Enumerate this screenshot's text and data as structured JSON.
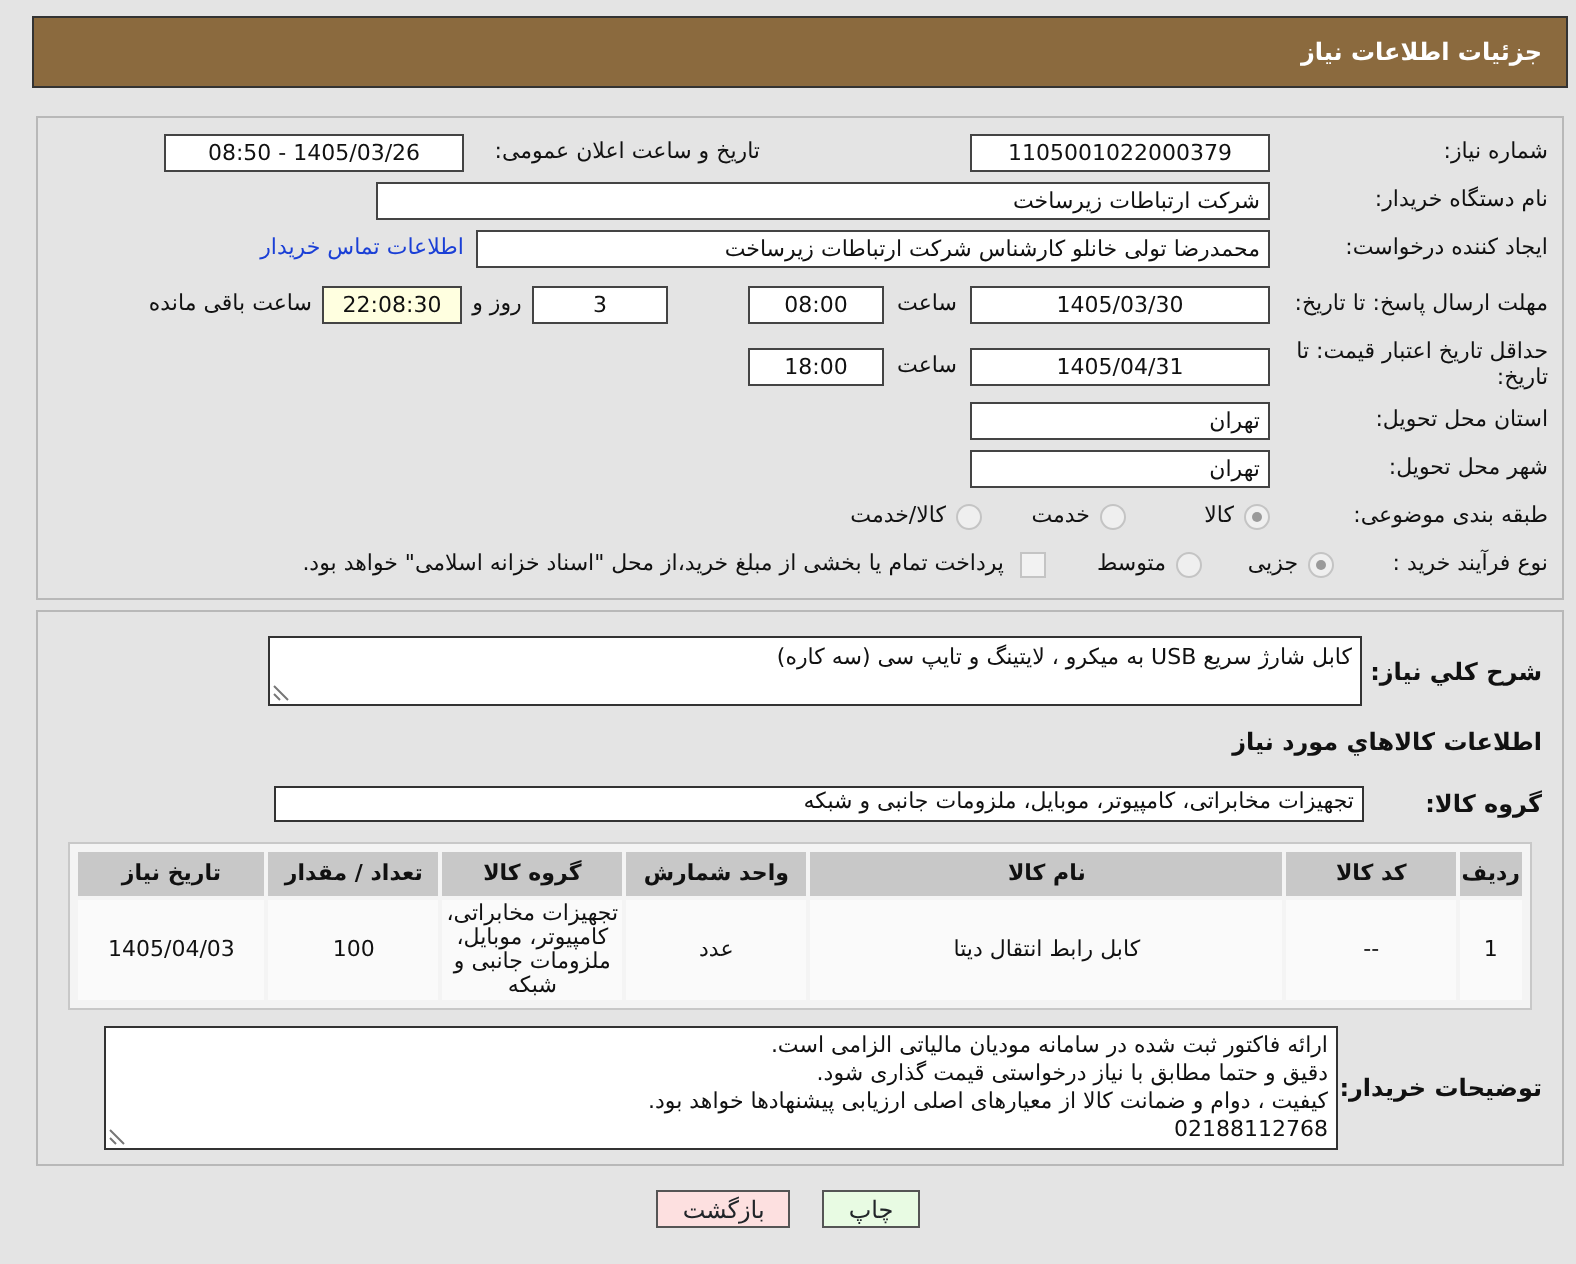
{
  "page_title": "جزئیات اطلاعات نیاز",
  "need_number": {
    "label": "شماره نیاز:",
    "value": "1105001022000379"
  },
  "announce": {
    "label": "تاریخ و ساعت اعلان عمومی:",
    "value": "1405/03/26 - 08:50"
  },
  "buyer_org": {
    "label": "نام دستگاه خریدار:",
    "value": "شرکت ارتباطات زیرساخت"
  },
  "creator": {
    "label": "ایجاد کننده درخواست:",
    "value": "محمدرضا تولی خانلو کارشناس شرکت ارتباطات زیرساخت",
    "link": "اطلاعات تماس خریدار"
  },
  "deadline": {
    "label": "مهلت ارسال پاسخ: تا تاریخ:",
    "date": "1405/03/30",
    "time_label": "ساعت",
    "time": "08:00",
    "days": "3",
    "days_label": "روز و",
    "remaining": "22:08:30",
    "remaining_label": "ساعت باقی مانده"
  },
  "validity": {
    "label": "حداقل تاریخ اعتبار قیمت: تا تاریخ:",
    "date": "1405/04/31",
    "time_label": "ساعت",
    "time": "18:00"
  },
  "province": {
    "label": "استان محل تحویل:",
    "value": "تهران"
  },
  "city": {
    "label": "شهر محل تحویل:",
    "value": "تهران"
  },
  "category": {
    "label": "طبقه بندی موضوعی:",
    "options": [
      {
        "label": "کالا",
        "selected": true
      },
      {
        "label": "خدمت",
        "selected": false
      },
      {
        "label": "کالا/خدمت",
        "selected": false
      }
    ]
  },
  "process": {
    "label": "نوع فرآیند خرید :",
    "options": [
      {
        "label": "جزیی",
        "selected": true
      },
      {
        "label": "متوسط",
        "selected": false
      }
    ],
    "payment": {
      "label": "پرداخت تمام یا بخشی از مبلغ خرید،از محل \"اسناد خزانه اسلامی\" خواهد بود.",
      "checked": false
    }
  },
  "description": {
    "label": "شرح كلي نياز:",
    "value": "کابل شارژ سریع USB به میکرو ، لایتینگ و تایپ سی (سه کاره)"
  },
  "goods_title": "اطلاعات كالاهاي مورد نياز",
  "goods_group": {
    "label": "گروه کالا:",
    "value": "تجهیزات مخابراتی، کامپیوتر، موبایل، ملزومات جانبی و شبکه"
  },
  "table": {
    "columns": [
      "ردیف",
      "کد کالا",
      "نام کالا",
      "واحد شمارش",
      "گروه کالا",
      "تعداد / مقدار",
      "تاریخ نیاز"
    ],
    "rows": [
      [
        "1",
        "--",
        "کابل رابط انتقال دیتا",
        "عدد",
        "تجهیزات مخابراتی، کامپیوتر، موبایل، ملزومات جانبی و شبکه",
        "100",
        "1405/04/03"
      ]
    ]
  },
  "buyer_notes": {
    "label": "توضیحات خریدار:",
    "lines": [
      "ارائه فاکتور ثبت شده در سامانه مودیان مالیاتی الزامی است.",
      "دقیق و حتما مطابق با نیاز درخواستی قیمت گذاری شود.",
      "کیفیت ، دوام و ضمانت کالا از معیارهای اصلی ارزیابی پیشنهادها خواهد بود.",
      "02188112768"
    ]
  },
  "buttons": [
    {
      "kind": "print",
      "label": "چاپ"
    },
    {
      "kind": "back",
      "label": "بازگشت"
    }
  ]
}
